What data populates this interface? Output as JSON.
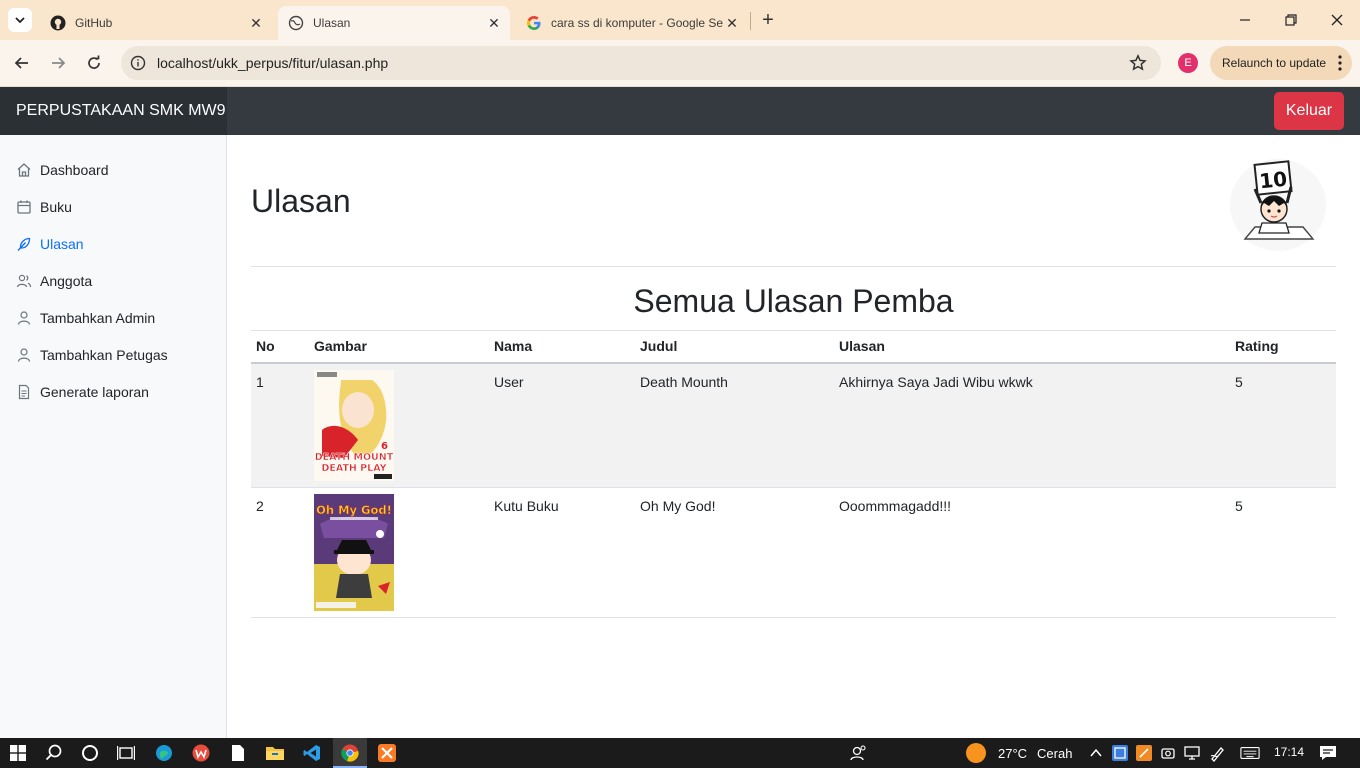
{
  "browser": {
    "tabs": [
      {
        "title": "GitHub",
        "icon": "github-icon",
        "active": false
      },
      {
        "title": "Ulasan",
        "icon": "globe-icon",
        "active": true
      },
      {
        "title": "cara ss di komputer - Google Se",
        "icon": "google-icon",
        "active": false
      }
    ],
    "url": "localhost/ukk_perpus/fitur/ulasan.php",
    "profile_initial": "E",
    "relaunch_label": "Relaunch to update"
  },
  "app": {
    "brand": "PERPUSTAKAAN SMK MW9",
    "logout_label": "Keluar"
  },
  "sidebar": {
    "items": [
      {
        "label": "Dashboard",
        "icon": "home-icon",
        "active": false
      },
      {
        "label": "Buku",
        "icon": "calendar-icon",
        "active": false
      },
      {
        "label": "Ulasan",
        "icon": "feather-icon",
        "active": true
      },
      {
        "label": "Anggota",
        "icon": "users-icon",
        "active": false
      },
      {
        "label": "Tambahkan Admin",
        "icon": "user-icon",
        "active": false
      },
      {
        "label": "Tambahkan Petugas",
        "icon": "user-icon",
        "active": false
      },
      {
        "label": "Generate laporan",
        "icon": "file-text-icon",
        "active": false
      }
    ]
  },
  "main": {
    "page_title": "Ulasan",
    "section_title": "Semua Ulasan Pemba",
    "mascot_sign": "10",
    "table": {
      "headers": [
        "No",
        "Gambar",
        "Nama",
        "Judul",
        "Ulasan",
        "Rating"
      ],
      "rows": [
        {
          "no": "1",
          "cover_text_top": "DEATH MOUNT",
          "cover_text_bottom": "DEATH PLAY",
          "cover_vol": "6",
          "nama": "User",
          "judul": "Death Mounth",
          "ulasan": "Akhirnya Saya Jadi Wibu wkwk",
          "rating": "5"
        },
        {
          "no": "2",
          "cover_text_top": "Oh My God!",
          "cover_text_bottom": "",
          "cover_vol": "",
          "nama": "Kutu Buku",
          "judul": "Oh My God!",
          "ulasan": "Ooommmagadd!!!",
          "rating": "5"
        }
      ]
    }
  },
  "taskbar": {
    "temperature": "27°C",
    "weather": "Cerah",
    "time": "17:14"
  },
  "colors": {
    "tabstrip": "#f9e6cc",
    "navbar": "#343a40",
    "danger": "#dc3545",
    "link_active": "#0d6efd"
  }
}
